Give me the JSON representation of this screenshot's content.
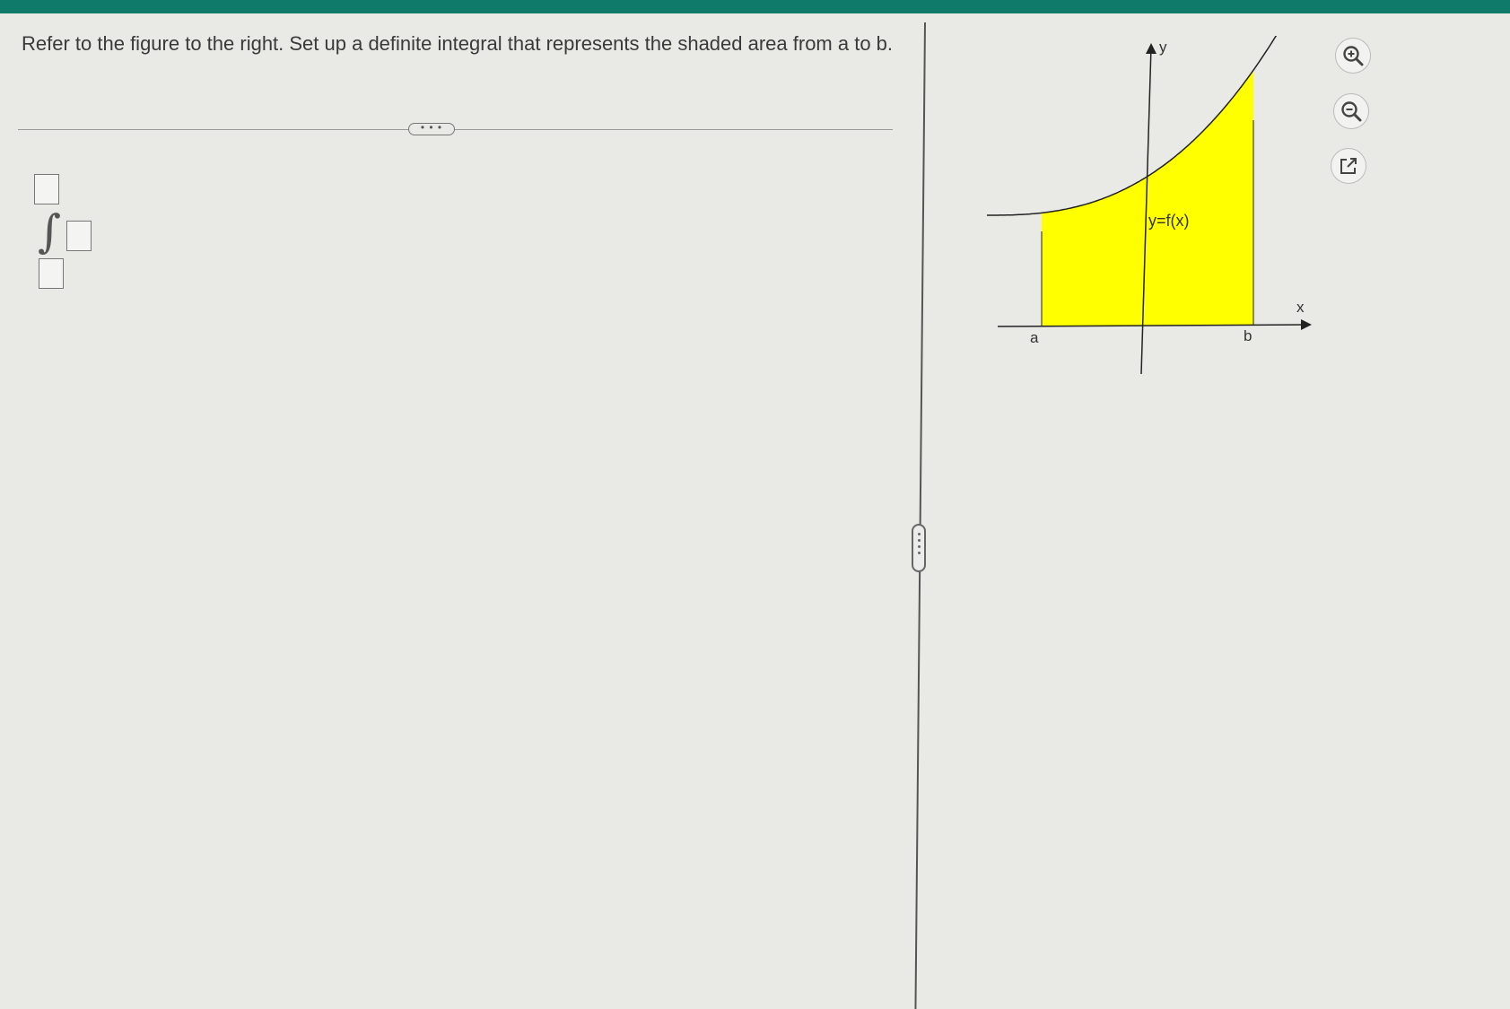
{
  "question": {
    "text": "Refer to the figure to the right.  Set up a definite integral that represents the shaded area from a to b."
  },
  "more_button": {
    "label": "• • •"
  },
  "figure": {
    "y_axis_label": "y",
    "x_axis_label": "x",
    "curve_label": "y=f(x)",
    "a_label": "a",
    "b_label": "b",
    "shade_color": "#ffff00",
    "chart_data": {
      "type": "area",
      "curve": "y=f(x)",
      "shaded_interval": [
        "a",
        "b"
      ]
    }
  },
  "tools": {
    "zoom_in_icon": "zoom-in-icon",
    "zoom_out_icon": "zoom-out-icon",
    "popout_icon": "external-link-icon"
  },
  "colors": {
    "accent": "#0f7a6a"
  }
}
